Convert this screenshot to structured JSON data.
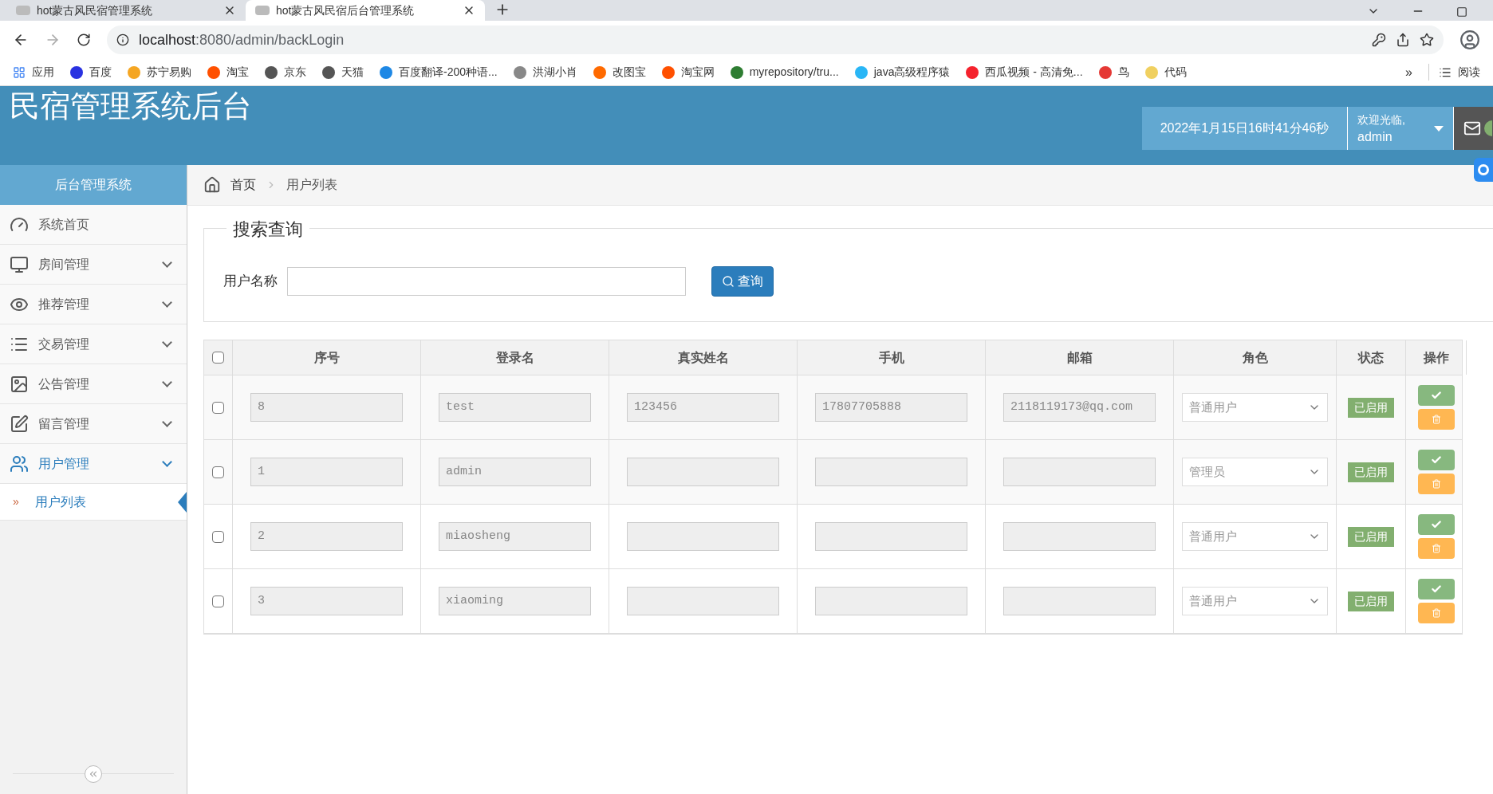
{
  "browser": {
    "tabs": [
      {
        "title": "hot蒙古风民宿管理系统",
        "selected": false
      },
      {
        "title": "hot蒙古风民宿后台管理系统",
        "selected": true
      }
    ],
    "url_host": "localhost",
    "url_path": ":8080/admin/backLogin",
    "bookmarks": [
      "应用",
      "百度",
      "苏宁易购",
      "淘宝",
      "京东",
      "天猫",
      "百度翻译-200种语...",
      "洪湖小肖",
      "改图宝",
      "淘宝网",
      "myrepository/tru...",
      "java高级程序猿",
      "西瓜视频 - 高清免...",
      "鸟",
      "代码"
    ],
    "more": "»",
    "reading_list": "阅读"
  },
  "header": {
    "title": "民宿管理系统后台",
    "datetime": "2022年1月15日16时41分46秒",
    "welcome": "欢迎光临,",
    "user": "admin"
  },
  "sidebar": {
    "title": "后台管理系统",
    "items": [
      {
        "label": "系统首页",
        "expandable": false,
        "selected": false
      },
      {
        "label": "房间管理",
        "expandable": true,
        "expanded": false,
        "selected": false
      },
      {
        "label": "推荐管理",
        "expandable": true,
        "expanded": false,
        "selected": false
      },
      {
        "label": "交易管理",
        "expandable": true,
        "expanded": false,
        "selected": false
      },
      {
        "label": "公告管理",
        "expandable": true,
        "expanded": false,
        "selected": false
      },
      {
        "label": "留言管理",
        "expandable": true,
        "expanded": false,
        "selected": false
      },
      {
        "label": "用户管理",
        "expandable": true,
        "expanded": true,
        "selected": true,
        "children": [
          {
            "marker": "»",
            "label": "用户列表",
            "selected": true
          }
        ]
      }
    ]
  },
  "breadcrumb": [
    "首页",
    "用户列表"
  ],
  "search": {
    "legend": "搜索查询",
    "label": "用户名称",
    "button": "查询"
  },
  "table": {
    "select_all_checked": false,
    "columns": [
      "序号",
      "登录名",
      "真实姓名",
      "手机",
      "邮箱",
      "角色",
      "状态",
      "操作"
    ],
    "rows": [
      {
        "checked": false,
        "id": "8",
        "login": "test",
        "realname": "123456",
        "phone": "17807705888",
        "email": "2118119173@qq.com",
        "role": "普通用户",
        "status": "已启用"
      },
      {
        "checked": false,
        "id": "1",
        "login": "admin",
        "role": "管理员",
        "status": "已启用"
      },
      {
        "checked": false,
        "id": "2",
        "login": "miaosheng",
        "role": "普通用户",
        "status": "已启用"
      },
      {
        "checked": false,
        "id": "3",
        "login": "xiaoming",
        "role": "普通用户",
        "status": "已启用"
      }
    ]
  }
}
